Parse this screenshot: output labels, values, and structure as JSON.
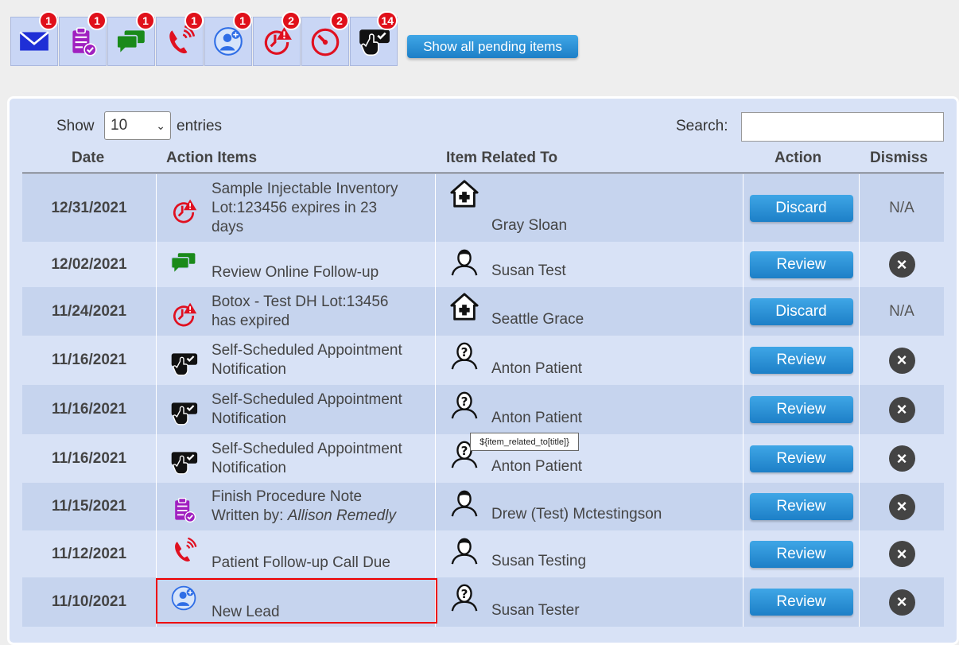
{
  "iconbar": [
    {
      "icon": "envelope-icon",
      "badge": "1",
      "color": "#1f2fd6"
    },
    {
      "icon": "clipboard-check-icon",
      "badge": "1",
      "color": "#a020c0"
    },
    {
      "icon": "chat-bubbles-icon",
      "badge": "1",
      "color": "#1a8a1a"
    },
    {
      "icon": "phone-ringing-icon",
      "badge": "1",
      "color": "#e01020"
    },
    {
      "icon": "user-add-icon",
      "badge": "1",
      "color": "#2f6ee6"
    },
    {
      "icon": "timer-alert-icon",
      "badge": "2",
      "color": "#e01020"
    },
    {
      "icon": "clock-expired-icon",
      "badge": "2",
      "color": "#e01020"
    },
    {
      "icon": "hand-tap-icon",
      "badge": "14",
      "color": "#111111"
    }
  ],
  "pending_button": "Show all pending items",
  "controls": {
    "show_label": "Show",
    "show_value": "10",
    "entries_label": "entries",
    "search_label": "Search:",
    "search_value": ""
  },
  "columns": {
    "date": "Date",
    "items": "Action Items",
    "related": "Item Related To",
    "action": "Action",
    "dismiss": "Dismiss"
  },
  "rows": [
    {
      "date": "12/31/2021",
      "icon": "timer-alert-icon",
      "lines": [
        "Sample Injectable Inventory",
        "Lot:123456 expires in 23",
        "days"
      ],
      "rel_icon": "facility-icon",
      "related": "Gray Sloan",
      "action": "Discard",
      "dismiss": "N/A"
    },
    {
      "date": "12/02/2021",
      "icon": "chat-bubbles-icon",
      "lines": [
        "Review Online Follow-up"
      ],
      "rel_icon": "person-icon",
      "related": "Susan Test",
      "action": "Review",
      "dismiss": "x"
    },
    {
      "date": "11/24/2021",
      "icon": "timer-alert-icon",
      "lines": [
        "Botox - Test DH Lot:13456",
        "has expired"
      ],
      "rel_icon": "facility-icon",
      "related": "Seattle Grace",
      "action": "Discard",
      "dismiss": "N/A"
    },
    {
      "date": "11/16/2021",
      "icon": "hand-tap-icon",
      "lines": [
        "Self-Scheduled Appointment",
        "Notification"
      ],
      "rel_icon": "unknown-person-icon",
      "related": "Anton Patient",
      "action": "Review",
      "dismiss": "x"
    },
    {
      "date": "11/16/2021",
      "icon": "hand-tap-icon",
      "lines": [
        "Self-Scheduled Appointment",
        "Notification"
      ],
      "rel_icon": "unknown-person-icon",
      "related": "Anton Patient",
      "action": "Review",
      "dismiss": "x"
    },
    {
      "date": "11/16/2021",
      "icon": "hand-tap-icon",
      "lines": [
        "Self-Scheduled Appointment",
        "Notification"
      ],
      "rel_icon": "unknown-person-icon",
      "related": "Anton Patient",
      "action": "Review",
      "dismiss": "x"
    },
    {
      "date": "11/15/2021",
      "icon": "clipboard-check-icon",
      "lines": [
        "Finish Procedure Note"
      ],
      "line2_prefix": "Written by: ",
      "line2_italic": "Allison Remedly",
      "rel_icon": "person-icon",
      "related": "Drew (Test) Mctestingson",
      "action": "Review",
      "dismiss": "x"
    },
    {
      "date": "11/12/2021",
      "icon": "phone-ringing-icon",
      "lines": [
        "Patient Follow-up Call Due"
      ],
      "rel_icon": "person-icon",
      "related": "Susan Testing",
      "action": "Review",
      "dismiss": "x"
    },
    {
      "date": "11/10/2021",
      "icon": "user-add-icon",
      "lines": [
        "New Lead"
      ],
      "rel_icon": "unknown-person-icon",
      "related": "Susan Tester",
      "action": "Review",
      "dismiss": "x"
    }
  ],
  "tooltip": "${item_related_to[title]}"
}
